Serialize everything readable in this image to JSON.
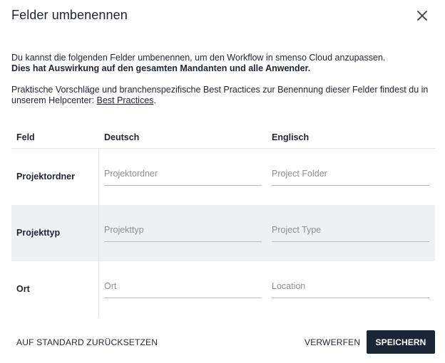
{
  "dialog": {
    "title": "Felder umbenennen"
  },
  "intro": {
    "line1": "Du kannst die folgenden Felder umbenennen, um den Workflow in smenso Cloud anzupassen.",
    "line2_bold": "Dies hat Auswirkung auf den gesamten Mandanten und alle Anwender.",
    "para2_text": "Praktische Vorschläge und branchenspezifische Best Practices zur Benennung dieser Felder findest du in unserem Helpcenter: ",
    "link_text": "Best Practices",
    "para2_end": "."
  },
  "table": {
    "headers": {
      "field": "Feld",
      "german": "Deutsch",
      "english": "Englisch"
    },
    "rows": [
      {
        "label": "Projektordner",
        "de_value": "",
        "de_placeholder": "Projektordner",
        "en_value": "",
        "en_placeholder": "Project Folder"
      },
      {
        "label": "Projekttyp",
        "de_value": "",
        "de_placeholder": "Projekttyp",
        "en_value": "",
        "en_placeholder": "Project Type"
      },
      {
        "label": "Ort",
        "de_value": "",
        "de_placeholder": "Ort",
        "en_value": "",
        "en_placeholder": "Location"
      }
    ]
  },
  "footer": {
    "reset_label": "AUF STANDARD ZURÜCKSETZEN",
    "discard_label": "VERWERFEN",
    "save_label": "SPEICHERN"
  },
  "icons": {
    "close": "close-icon"
  },
  "colors": {
    "primary_button": "#1a2638",
    "row_shade": "#eef0f2"
  }
}
